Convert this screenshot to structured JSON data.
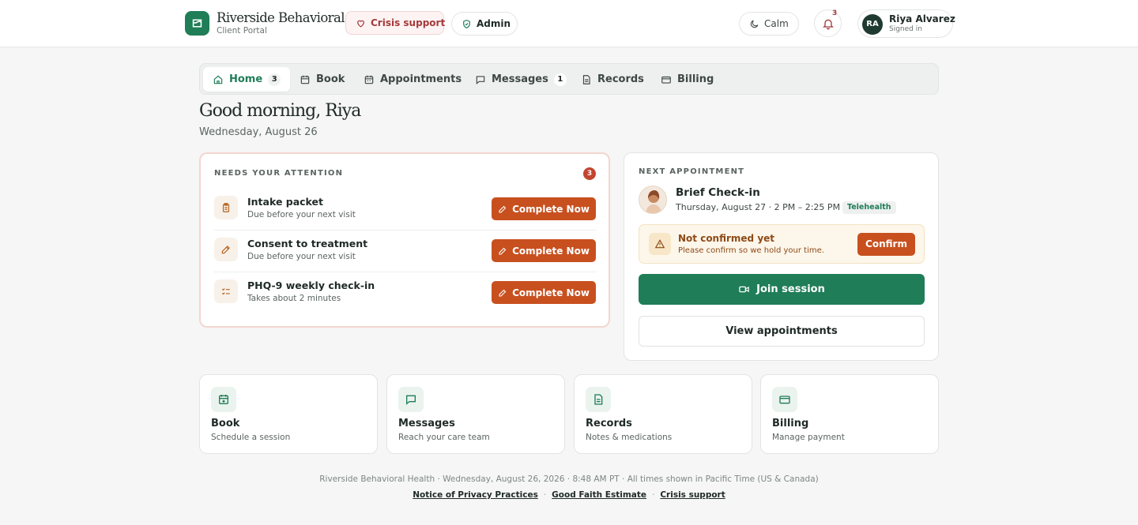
{
  "header": {
    "brand_title": "Riverside Behavioral Health",
    "brand_subtitle": "Client Portal",
    "crisis_label": "Crisis support",
    "admin_label": "Admin",
    "theme_label": "Calm",
    "notification_count": "3",
    "user_initials": "RA",
    "user_name": "Riya Alvarez",
    "user_status": "Signed in"
  },
  "tabs": [
    {
      "label": "Home",
      "badge": "3",
      "icon": "home-icon",
      "active": true
    },
    {
      "label": "Book",
      "badge": "",
      "icon": "calendar-plus-icon"
    },
    {
      "label": "Appointments",
      "badge": "",
      "icon": "calendar-icon"
    },
    {
      "label": "Messages",
      "badge": "1",
      "icon": "message-icon"
    },
    {
      "label": "Records",
      "badge": "",
      "icon": "document-icon"
    },
    {
      "label": "Billing",
      "badge": "",
      "icon": "card-icon"
    }
  ],
  "greeting": {
    "title": "Good morning, Riya",
    "date": "Wednesday, August 26"
  },
  "attention": {
    "label": "NEEDS YOUR ATTENTION",
    "count": "3",
    "tasks": [
      {
        "title": "Intake packet",
        "subtitle": "Due before your next visit",
        "action": "Complete Now",
        "icon": "clipboard-icon"
      },
      {
        "title": "Consent to treatment",
        "subtitle": "Due before your next visit",
        "action": "Complete Now",
        "icon": "pen-icon"
      },
      {
        "title": "PHQ-9 weekly check-in",
        "subtitle": "Takes about 2 minutes",
        "action": "Complete Now",
        "icon": "checklist-icon"
      }
    ]
  },
  "appointment": {
    "label": "NEXT APPOINTMENT",
    "title": "Brief Check-in",
    "time": "Thursday, August 27 · 2 PM – 2:25 PM",
    "badge": "Telehealth",
    "warning_title": "Not confirmed yet",
    "warning_subtitle": "Please confirm so we hold your time.",
    "confirm_label": "Confirm",
    "join_label": "Join session",
    "view_label": "View appointments"
  },
  "shortcuts": [
    {
      "title": "Book",
      "subtitle": "Schedule a session",
      "icon": "calendar-plus-icon"
    },
    {
      "title": "Messages",
      "subtitle": "Reach your care team",
      "icon": "message-icon"
    },
    {
      "title": "Records",
      "subtitle": "Notes & medications",
      "icon": "document-icon"
    },
    {
      "title": "Billing",
      "subtitle": "Manage payment",
      "icon": "card-icon"
    }
  ],
  "footer": {
    "line": "Riverside Behavioral Health · Wednesday, August 26, 2026 · 8:48 AM PT · All times shown in Pacific Time (US & Canada)",
    "links": [
      "Notice of Privacy Practices",
      "Good Faith Estimate",
      "Crisis support"
    ]
  },
  "colors": {
    "brand_green": "#1f7d58",
    "action_orange": "#c8501f",
    "alert_red": "#c2452f",
    "warning_bg": "#fdf6ea"
  }
}
